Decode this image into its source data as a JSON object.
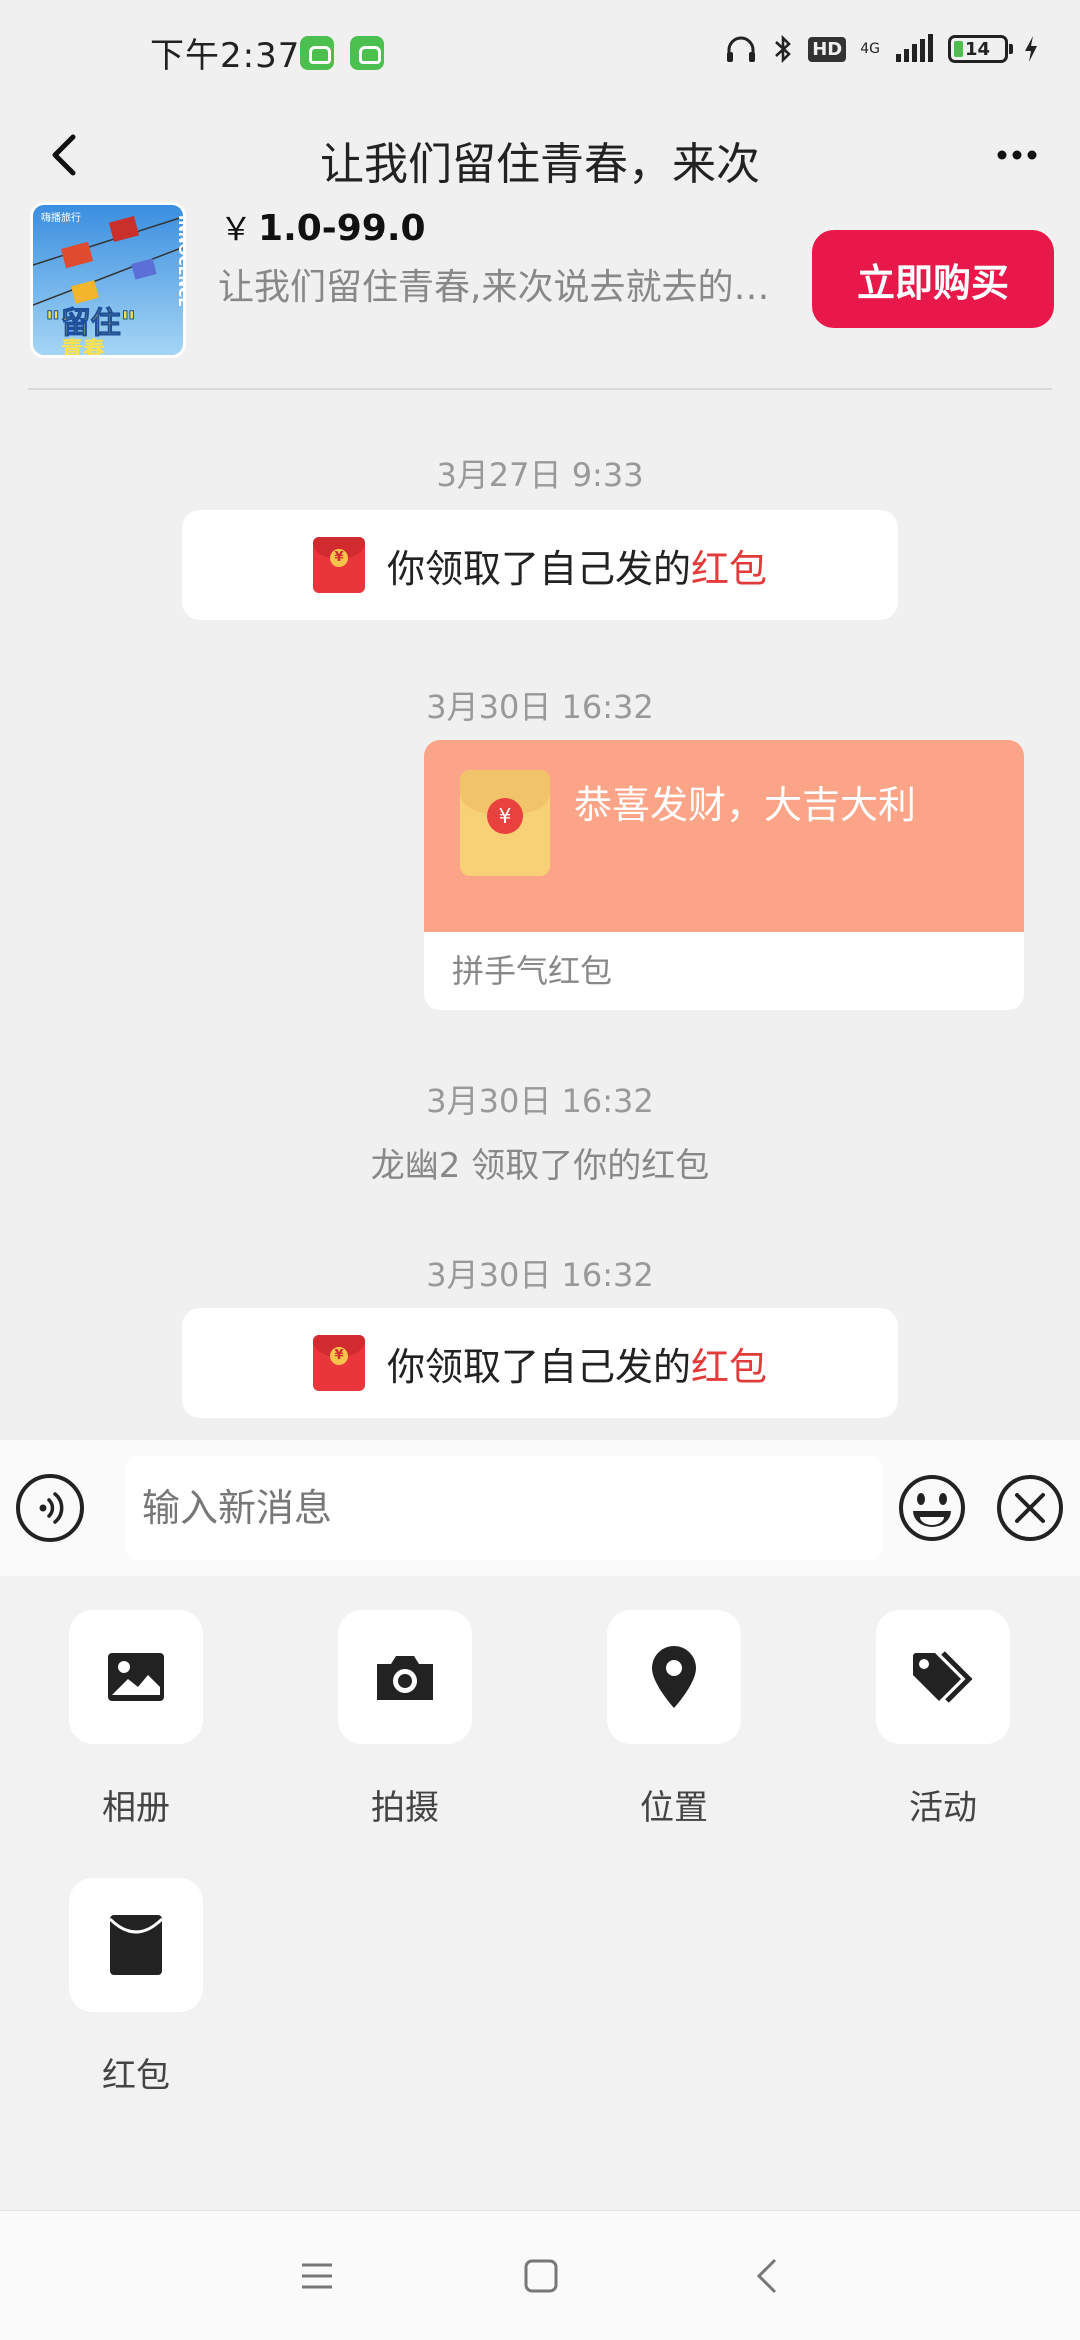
{
  "status_bar": {
    "time": "下午2:37",
    "hd_label": "HD",
    "network": "4G",
    "battery": "14"
  },
  "header": {
    "title": "让我们留住青春，来次"
  },
  "product": {
    "currency": "￥",
    "price": "1.0-99.0",
    "description": "让我们留住青春,来次说去就去的旅行",
    "buy_label": "立即购买",
    "image_text_vertical": "INNOCENCE",
    "image_text_main": "\"留住\"",
    "image_text_sub": "青春",
    "image_text_top": "嗨播旅行"
  },
  "chat": {
    "messages": [
      {
        "timestamp": "3月27日 9:33",
        "text": "你领取了自己发的",
        "highlight": "红包"
      },
      {
        "timestamp": "3月30日 16:32",
        "greeting": "恭喜发财，大吉大利",
        "footer": "拼手气红包"
      },
      {
        "timestamp": "3月30日 16:32",
        "text": "龙幽2 领取了你的红包"
      },
      {
        "timestamp": "3月30日 16:32",
        "text": "你领取了自己发的",
        "highlight": "红包"
      }
    ]
  },
  "input": {
    "placeholder": "输入新消息"
  },
  "tools": [
    {
      "label": "相册",
      "icon": "image-icon"
    },
    {
      "label": "拍摄",
      "icon": "camera-icon"
    },
    {
      "label": "位置",
      "icon": "location-pin-icon"
    },
    {
      "label": "活动",
      "icon": "tags-icon"
    },
    {
      "label": "红包",
      "icon": "red-packet-icon"
    }
  ],
  "colors": {
    "accent_red": "#e8184a",
    "packet_orange": "#fba487",
    "highlight_red": "#e33a3a"
  }
}
